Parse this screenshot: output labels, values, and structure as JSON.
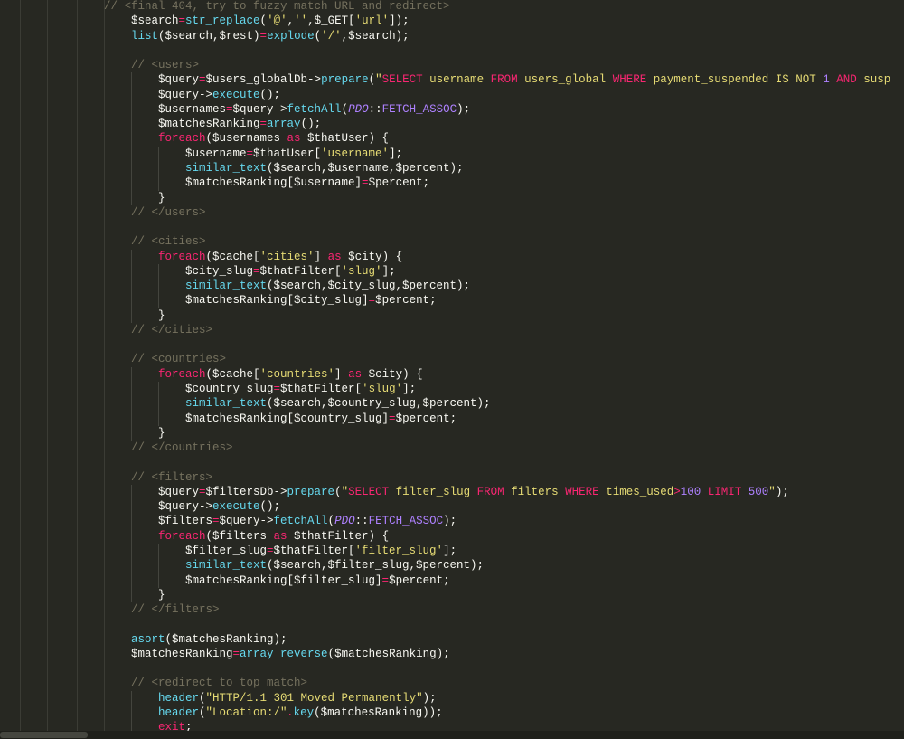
{
  "editor": {
    "language": "PHP",
    "theme_colors": {
      "background": "#272822",
      "keyword": "#f92672",
      "function": "#66d9ef",
      "string": "#e6db74",
      "comment": "#75715e",
      "number": "#ae81ff"
    }
  },
  "lines": [
    {
      "i": 4,
      "t": [
        {
          "v": "// <final 404, try to fuzzy match URL and redirect>",
          "c": "c"
        }
      ]
    },
    {
      "i": 5,
      "t": [
        {
          "v": "$search",
          "c": "p"
        },
        {
          "v": "=",
          "c": "k"
        },
        {
          "v": "str_replace",
          "c": "f"
        },
        {
          "v": "(",
          "c": "p"
        },
        {
          "v": "'@'",
          "c": "s"
        },
        {
          "v": ",",
          "c": "p"
        },
        {
          "v": "''",
          "c": "s"
        },
        {
          "v": ",$_GET[",
          "c": "p"
        },
        {
          "v": "'url'",
          "c": "s"
        },
        {
          "v": "]);",
          "c": "p"
        }
      ]
    },
    {
      "i": 5,
      "t": [
        {
          "v": "list",
          "c": "f"
        },
        {
          "v": "($search,$rest)",
          "c": "p"
        },
        {
          "v": "=",
          "c": "k"
        },
        {
          "v": "explode",
          "c": "f"
        },
        {
          "v": "(",
          "c": "p"
        },
        {
          "v": "'/'",
          "c": "s"
        },
        {
          "v": ",$search);",
          "c": "p"
        }
      ]
    },
    {
      "i": 0,
      "t": []
    },
    {
      "i": 5,
      "t": [
        {
          "v": "// <users>",
          "c": "c"
        }
      ]
    },
    {
      "i": 6,
      "t": [
        {
          "v": "$query",
          "c": "p"
        },
        {
          "v": "=",
          "c": "k"
        },
        {
          "v": "$users_globalDb->",
          "c": "p"
        },
        {
          "v": "prepare",
          "c": "f"
        },
        {
          "v": "(",
          "c": "p"
        },
        {
          "v": "\"",
          "c": "s"
        },
        {
          "v": "SELECT",
          "c": "k"
        },
        {
          "v": " username ",
          "c": "s"
        },
        {
          "v": "FROM",
          "c": "k"
        },
        {
          "v": " users_global ",
          "c": "s"
        },
        {
          "v": "WHERE",
          "c": "k"
        },
        {
          "v": " payment_suspended IS NOT ",
          "c": "s"
        },
        {
          "v": "1",
          "c": "n"
        },
        {
          "v": " ",
          "c": "s"
        },
        {
          "v": "AND",
          "c": "k"
        },
        {
          "v": " susp",
          "c": "s"
        }
      ]
    },
    {
      "i": 6,
      "t": [
        {
          "v": "$query->",
          "c": "p"
        },
        {
          "v": "execute",
          "c": "f"
        },
        {
          "v": "();",
          "c": "p"
        }
      ]
    },
    {
      "i": 6,
      "t": [
        {
          "v": "$usernames",
          "c": "p"
        },
        {
          "v": "=",
          "c": "k"
        },
        {
          "v": "$query->",
          "c": "p"
        },
        {
          "v": "fetchAll",
          "c": "f"
        },
        {
          "v": "(",
          "c": "p"
        },
        {
          "v": "PDO",
          "c": "i"
        },
        {
          "v": "::",
          "c": "p"
        },
        {
          "v": "FETCH_ASSOC",
          "c": "n"
        },
        {
          "v": ");",
          "c": "p"
        }
      ]
    },
    {
      "i": 6,
      "t": [
        {
          "v": "$matchesRanking",
          "c": "p"
        },
        {
          "v": "=",
          "c": "k"
        },
        {
          "v": "array",
          "c": "f"
        },
        {
          "v": "();",
          "c": "p"
        }
      ]
    },
    {
      "i": 6,
      "t": [
        {
          "v": "foreach",
          "c": "k"
        },
        {
          "v": "($usernames ",
          "c": "p"
        },
        {
          "v": "as",
          "c": "k"
        },
        {
          "v": " $thatUser) {",
          "c": "p"
        }
      ]
    },
    {
      "i": 7,
      "t": [
        {
          "v": "$username",
          "c": "p"
        },
        {
          "v": "=",
          "c": "k"
        },
        {
          "v": "$thatUser[",
          "c": "p"
        },
        {
          "v": "'username'",
          "c": "s"
        },
        {
          "v": "];",
          "c": "p"
        }
      ]
    },
    {
      "i": 7,
      "t": [
        {
          "v": "similar_text",
          "c": "f"
        },
        {
          "v": "($search,$username,$percent);",
          "c": "p"
        }
      ]
    },
    {
      "i": 7,
      "t": [
        {
          "v": "$matchesRanking[$username]",
          "c": "p"
        },
        {
          "v": "=",
          "c": "k"
        },
        {
          "v": "$percent;",
          "c": "p"
        }
      ]
    },
    {
      "i": 6,
      "t": [
        {
          "v": "}",
          "c": "p"
        }
      ]
    },
    {
      "i": 5,
      "t": [
        {
          "v": "// </users>",
          "c": "c"
        }
      ]
    },
    {
      "i": 0,
      "t": []
    },
    {
      "i": 5,
      "t": [
        {
          "v": "// <cities>",
          "c": "c"
        }
      ]
    },
    {
      "i": 6,
      "t": [
        {
          "v": "foreach",
          "c": "k"
        },
        {
          "v": "($cache[",
          "c": "p"
        },
        {
          "v": "'cities'",
          "c": "s"
        },
        {
          "v": "] ",
          "c": "p"
        },
        {
          "v": "as",
          "c": "k"
        },
        {
          "v": " $city) {",
          "c": "p"
        }
      ]
    },
    {
      "i": 7,
      "t": [
        {
          "v": "$city_slug",
          "c": "p"
        },
        {
          "v": "=",
          "c": "k"
        },
        {
          "v": "$thatFilter[",
          "c": "p"
        },
        {
          "v": "'slug'",
          "c": "s"
        },
        {
          "v": "];",
          "c": "p"
        }
      ]
    },
    {
      "i": 7,
      "t": [
        {
          "v": "similar_text",
          "c": "f"
        },
        {
          "v": "($search,$city_slug,$percent);",
          "c": "p"
        }
      ]
    },
    {
      "i": 7,
      "t": [
        {
          "v": "$matchesRanking[$city_slug]",
          "c": "p"
        },
        {
          "v": "=",
          "c": "k"
        },
        {
          "v": "$percent;",
          "c": "p"
        }
      ]
    },
    {
      "i": 6,
      "t": [
        {
          "v": "}",
          "c": "p"
        }
      ]
    },
    {
      "i": 5,
      "t": [
        {
          "v": "// </cities>",
          "c": "c"
        }
      ]
    },
    {
      "i": 0,
      "t": []
    },
    {
      "i": 5,
      "t": [
        {
          "v": "// <countries>",
          "c": "c"
        }
      ]
    },
    {
      "i": 6,
      "t": [
        {
          "v": "foreach",
          "c": "k"
        },
        {
          "v": "($cache[",
          "c": "p"
        },
        {
          "v": "'countries'",
          "c": "s"
        },
        {
          "v": "] ",
          "c": "p"
        },
        {
          "v": "as",
          "c": "k"
        },
        {
          "v": " $city) {",
          "c": "p"
        }
      ]
    },
    {
      "i": 7,
      "t": [
        {
          "v": "$country_slug",
          "c": "p"
        },
        {
          "v": "=",
          "c": "k"
        },
        {
          "v": "$thatFilter[",
          "c": "p"
        },
        {
          "v": "'slug'",
          "c": "s"
        },
        {
          "v": "];",
          "c": "p"
        }
      ]
    },
    {
      "i": 7,
      "t": [
        {
          "v": "similar_text",
          "c": "f"
        },
        {
          "v": "($search,$country_slug,$percent);",
          "c": "p"
        }
      ]
    },
    {
      "i": 7,
      "t": [
        {
          "v": "$matchesRanking[$country_slug]",
          "c": "p"
        },
        {
          "v": "=",
          "c": "k"
        },
        {
          "v": "$percent;",
          "c": "p"
        }
      ]
    },
    {
      "i": 6,
      "t": [
        {
          "v": "}",
          "c": "p"
        }
      ]
    },
    {
      "i": 5,
      "t": [
        {
          "v": "// </countries>",
          "c": "c"
        }
      ]
    },
    {
      "i": 0,
      "t": []
    },
    {
      "i": 5,
      "t": [
        {
          "v": "// <filters>",
          "c": "c"
        }
      ]
    },
    {
      "i": 6,
      "t": [
        {
          "v": "$query",
          "c": "p"
        },
        {
          "v": "=",
          "c": "k"
        },
        {
          "v": "$filtersDb->",
          "c": "p"
        },
        {
          "v": "prepare",
          "c": "f"
        },
        {
          "v": "(",
          "c": "p"
        },
        {
          "v": "\"",
          "c": "s"
        },
        {
          "v": "SELECT",
          "c": "k"
        },
        {
          "v": " filter_slug ",
          "c": "s"
        },
        {
          "v": "FROM",
          "c": "k"
        },
        {
          "v": " filters ",
          "c": "s"
        },
        {
          "v": "WHERE",
          "c": "k"
        },
        {
          "v": " times_used",
          "c": "s"
        },
        {
          "v": ">",
          "c": "k"
        },
        {
          "v": "100",
          "c": "n"
        },
        {
          "v": " ",
          "c": "s"
        },
        {
          "v": "LIMIT",
          "c": "k"
        },
        {
          "v": " ",
          "c": "s"
        },
        {
          "v": "500",
          "c": "n"
        },
        {
          "v": "\"",
          "c": "s"
        },
        {
          "v": ");",
          "c": "p"
        }
      ]
    },
    {
      "i": 6,
      "t": [
        {
          "v": "$query->",
          "c": "p"
        },
        {
          "v": "execute",
          "c": "f"
        },
        {
          "v": "();",
          "c": "p"
        }
      ]
    },
    {
      "i": 6,
      "t": [
        {
          "v": "$filters",
          "c": "p"
        },
        {
          "v": "=",
          "c": "k"
        },
        {
          "v": "$query->",
          "c": "p"
        },
        {
          "v": "fetchAll",
          "c": "f"
        },
        {
          "v": "(",
          "c": "p"
        },
        {
          "v": "PDO",
          "c": "i"
        },
        {
          "v": "::",
          "c": "p"
        },
        {
          "v": "FETCH_ASSOC",
          "c": "n"
        },
        {
          "v": ");",
          "c": "p"
        }
      ]
    },
    {
      "i": 6,
      "t": [
        {
          "v": "foreach",
          "c": "k"
        },
        {
          "v": "($filters ",
          "c": "p"
        },
        {
          "v": "as",
          "c": "k"
        },
        {
          "v": " $thatFilter) {",
          "c": "p"
        }
      ]
    },
    {
      "i": 7,
      "t": [
        {
          "v": "$filter_slug",
          "c": "p"
        },
        {
          "v": "=",
          "c": "k"
        },
        {
          "v": "$thatFilter[",
          "c": "p"
        },
        {
          "v": "'filter_slug'",
          "c": "s"
        },
        {
          "v": "];",
          "c": "p"
        }
      ]
    },
    {
      "i": 7,
      "t": [
        {
          "v": "similar_text",
          "c": "f"
        },
        {
          "v": "($search,$filter_slug,$percent);",
          "c": "p"
        }
      ]
    },
    {
      "i": 7,
      "t": [
        {
          "v": "$matchesRanking[$filter_slug]",
          "c": "p"
        },
        {
          "v": "=",
          "c": "k"
        },
        {
          "v": "$percent;",
          "c": "p"
        }
      ]
    },
    {
      "i": 6,
      "t": [
        {
          "v": "}",
          "c": "p"
        }
      ]
    },
    {
      "i": 5,
      "t": [
        {
          "v": "// </filters>",
          "c": "c"
        }
      ]
    },
    {
      "i": 0,
      "t": []
    },
    {
      "i": 5,
      "t": [
        {
          "v": "asort",
          "c": "f"
        },
        {
          "v": "($matchesRanking);",
          "c": "p"
        }
      ]
    },
    {
      "i": 5,
      "t": [
        {
          "v": "$matchesRanking",
          "c": "p"
        },
        {
          "v": "=",
          "c": "k"
        },
        {
          "v": "array_reverse",
          "c": "f"
        },
        {
          "v": "($matchesRanking);",
          "c": "p"
        }
      ]
    },
    {
      "i": 0,
      "t": []
    },
    {
      "i": 5,
      "t": [
        {
          "v": "// <redirect to top match>",
          "c": "c"
        }
      ]
    },
    {
      "i": 6,
      "t": [
        {
          "v": "header",
          "c": "f"
        },
        {
          "v": "(",
          "c": "p"
        },
        {
          "v": "\"HTTP/1.1 301 Moved Permanently\"",
          "c": "s"
        },
        {
          "v": ");",
          "c": "p"
        }
      ]
    },
    {
      "i": 6,
      "t": [
        {
          "v": "header",
          "c": "f"
        },
        {
          "v": "(",
          "c": "p"
        },
        {
          "v": "\"Location:/\"",
          "c": "s"
        },
        {
          "v": ".",
          "c": "k",
          "cursor": true
        },
        {
          "v": "key",
          "c": "f"
        },
        {
          "v": "($matchesRanking));",
          "c": "p"
        }
      ]
    },
    {
      "i": 6,
      "t": [
        {
          "v": "exit",
          "c": "k"
        },
        {
          "v": ";",
          "c": "p"
        }
      ]
    }
  ]
}
